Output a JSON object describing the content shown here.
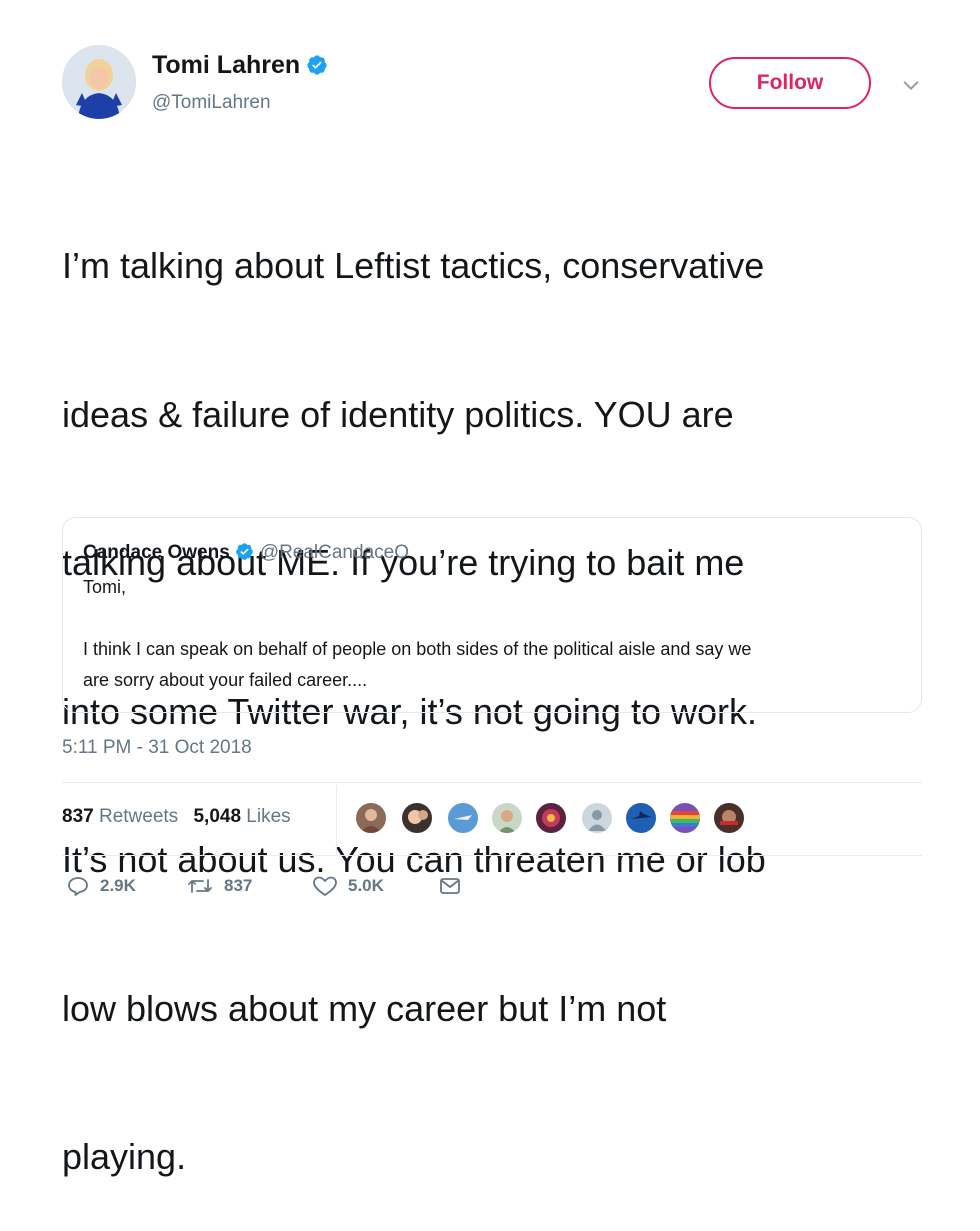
{
  "author": {
    "name": "Tomi Lahren",
    "handle": "@TomiLahren",
    "avatar_icon": "profile-photo"
  },
  "follow_label": "Follow",
  "tweet": {
    "lines": [
      "I’m talking about Leftist tactics, conservative",
      "ideas & failure of identity politics. YOU are",
      "talking about ME. If you’re trying to bait me",
      "into some Twitter war, it’s not going to work.",
      "It’s not about us. You can threaten me or lob",
      "low blows about my career but I’m not",
      "playing."
    ]
  },
  "quoted": {
    "name": "Candace Owens",
    "handle": "@RealCandaceO",
    "line1": "Tomi,",
    "line2": "I think I can speak on behalf of people on both sides of the political aisle and say we",
    "line3": "are sorry about your failed career...."
  },
  "timestamp": "5:11 PM - 31 Oct 2018",
  "stats": {
    "retweets_count": "837",
    "retweets_label": "Retweets",
    "likes_count": "5,048",
    "likes_label": "Likes"
  },
  "actions": {
    "reply_count": "2.9K",
    "retweet_count": "837",
    "like_count": "5.0K"
  },
  "colors": {
    "accent_follow": "#e0245e",
    "verified": "#1da1f2",
    "muted_text": "#657786"
  }
}
